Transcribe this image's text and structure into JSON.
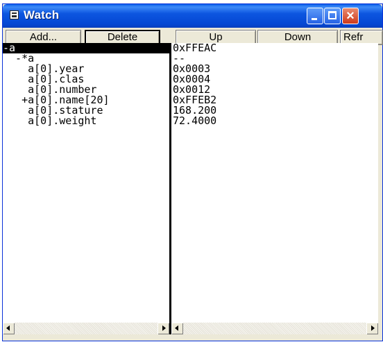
{
  "window": {
    "title": "Watch",
    "icon": "window-app-icon",
    "controls": {
      "minimize": "minimize",
      "maximize": "maximize",
      "close": "×"
    }
  },
  "toolbar": {
    "add_label": "Add...",
    "delete_label": "Delete",
    "up_label": "Up",
    "down_label": "Down",
    "refresh_label": "Refr"
  },
  "watch": {
    "rows": [
      {
        "label": "-a",
        "value": "0xFFEAC"
      },
      {
        "label": "  -*a",
        "value": "--"
      },
      {
        "label": "    a[0].year",
        "value": "0x0003"
      },
      {
        "label": "    a[0].clas",
        "value": "0x0004"
      },
      {
        "label": "    a[0].number",
        "value": "0x0012"
      },
      {
        "label": "   +a[0].name[20]",
        "value": "0xFFEB2"
      },
      {
        "label": "    a[0].stature",
        "value": "168.200"
      },
      {
        "label": "    a[0].weight",
        "value": "72.4000"
      }
    ]
  },
  "scrollbars": {
    "left_arrow": "scroll-left-arrow",
    "right_arrow": "scroll-right-arrow"
  },
  "colors": {
    "titlebar": "#0447d3",
    "selection_bg": "#000000",
    "selection_fg": "#ffffff",
    "close_button": "#cf3a1b"
  }
}
